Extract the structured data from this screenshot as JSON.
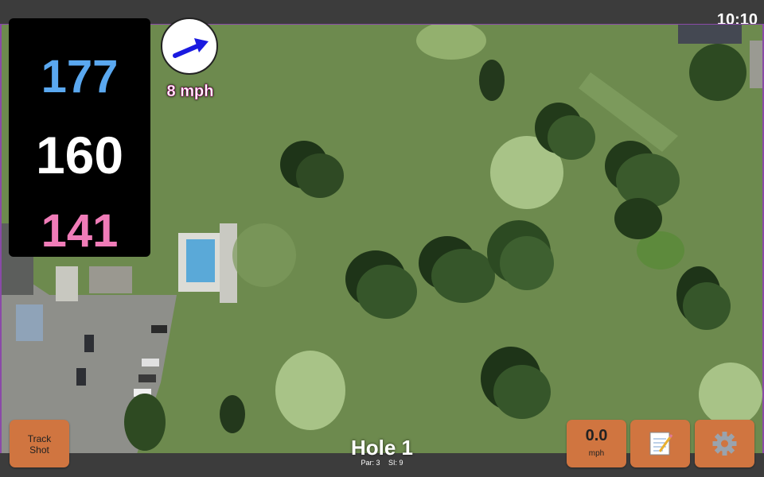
{
  "status_bar": {
    "time": "10:10"
  },
  "distances": {
    "back": "177",
    "middle": "160",
    "front": "141"
  },
  "wind": {
    "speed": "8 mph",
    "icon": "arrow-icon",
    "color": "#1a1ae0"
  },
  "colors": {
    "back": "#5aa8f0",
    "front": "#f07cb8",
    "button": "#d07540",
    "accent_border": "#8a4aa8"
  },
  "track_shot": {
    "line1": "Track",
    "line2": "Shot"
  },
  "speed_button": {
    "value": "0.0",
    "unit": "mph"
  },
  "note_button": {
    "icon": "notepad-icon"
  },
  "settings_button": {
    "icon": "gear-icon"
  },
  "hole": {
    "title": "Hole 1",
    "par": "Par: 3",
    "si": "SI: 9"
  }
}
